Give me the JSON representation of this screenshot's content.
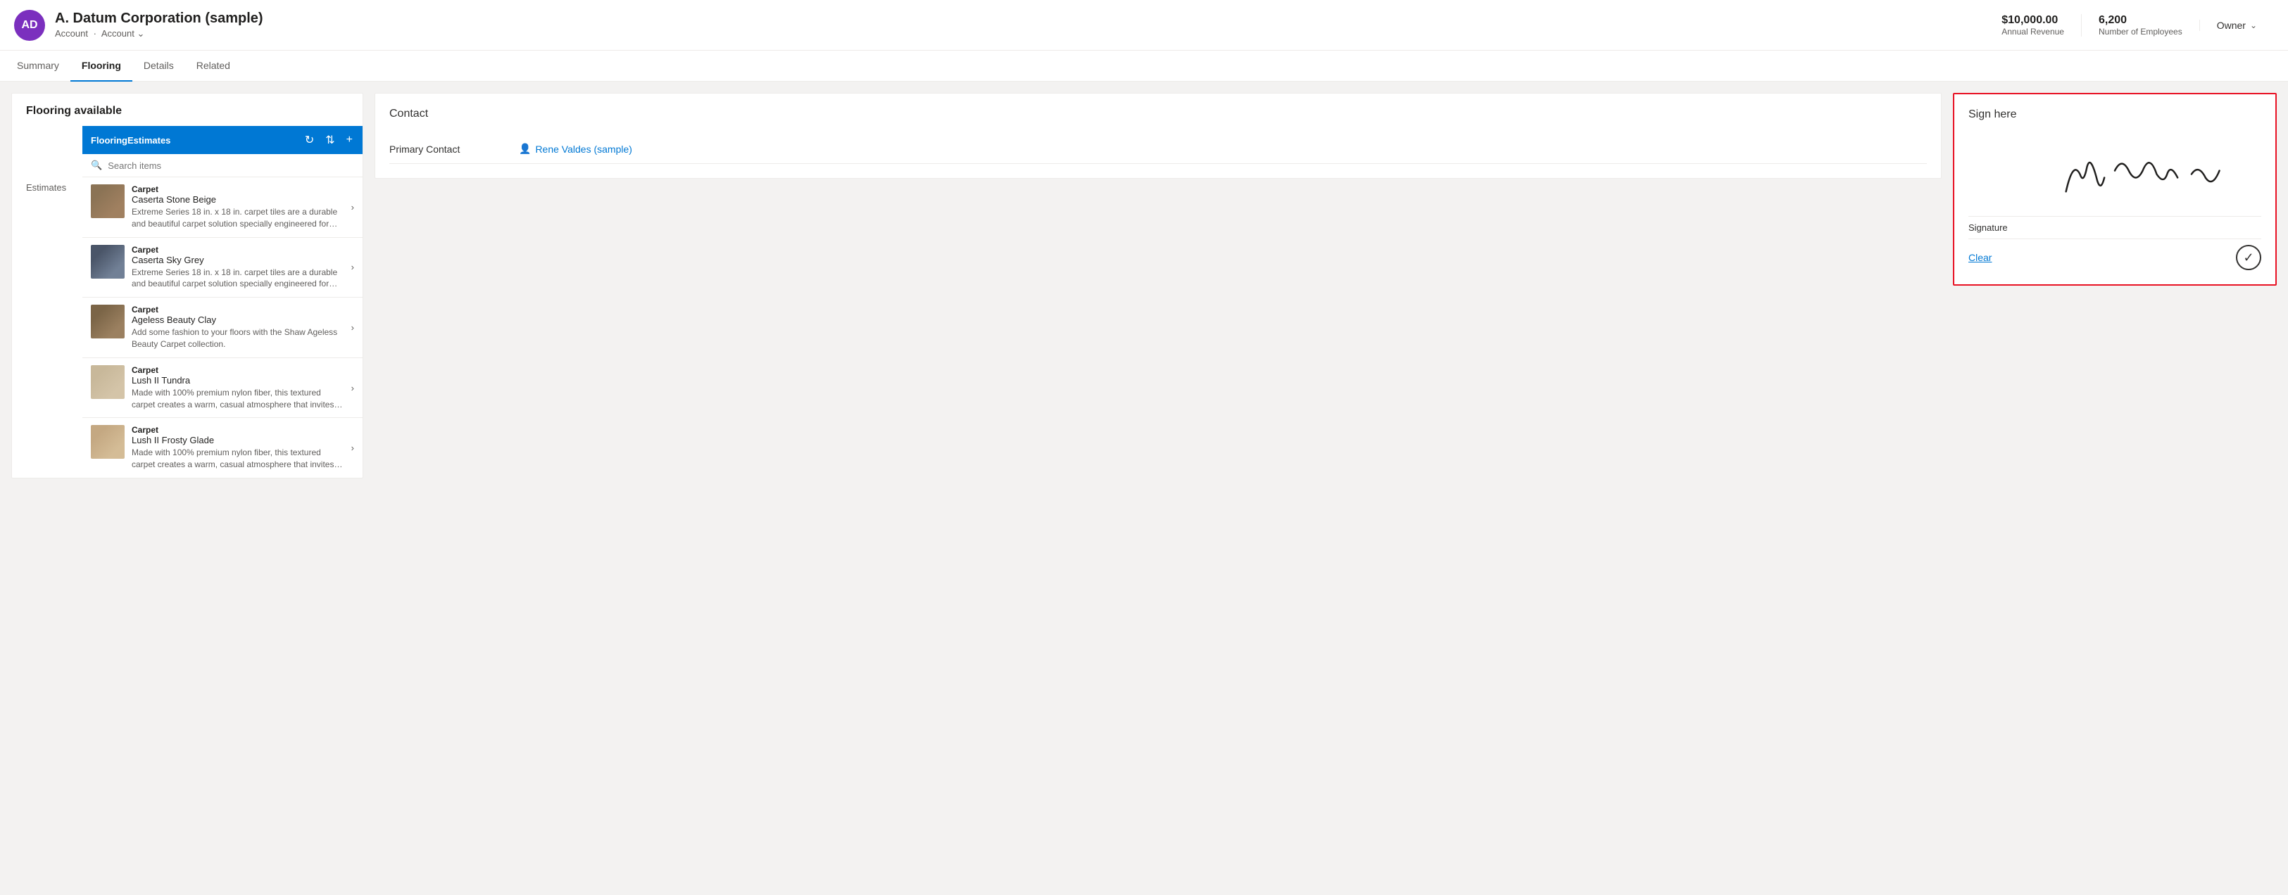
{
  "header": {
    "avatar_initials": "AD",
    "title": "A. Datum Corporation (sample)",
    "breadcrumb_part1": "Account",
    "breadcrumb_sep": "·",
    "breadcrumb_part2": "Account",
    "annual_revenue_value": "$10,000.00",
    "annual_revenue_label": "Annual Revenue",
    "employees_value": "6,200",
    "employees_label": "Number of Employees",
    "owner_label": "Owner"
  },
  "nav": {
    "tabs": [
      {
        "id": "summary",
        "label": "Summary",
        "active": false
      },
      {
        "id": "flooring",
        "label": "Flooring",
        "active": true
      },
      {
        "id": "details",
        "label": "Details",
        "active": false
      },
      {
        "id": "related",
        "label": "Related",
        "active": false
      }
    ]
  },
  "flooring_panel": {
    "title": "Flooring available",
    "estimates_label": "Estimates",
    "tab_label": "FlooringEstimates",
    "search_placeholder": "Search items",
    "products": [
      {
        "type": "Carpet",
        "name": "Caserta Stone Beige",
        "desc": "Extreme Series 18 in. x 18 in. carpet tiles are a durable and beautiful carpet solution specially engineered for both",
        "thumb_class": "thumb-beige"
      },
      {
        "type": "Carpet",
        "name": "Caserta Sky Grey",
        "desc": "Extreme Series 18 in. x 18 in. carpet tiles are a durable and beautiful carpet solution specially engineered for both",
        "thumb_class": "thumb-grey"
      },
      {
        "type": "Carpet",
        "name": "Ageless Beauty Clay",
        "desc": "Add some fashion to your floors with the Shaw Ageless Beauty Carpet collection.",
        "thumb_class": "thumb-clay"
      },
      {
        "type": "Carpet",
        "name": "Lush II Tundra",
        "desc": "Made with 100% premium nylon fiber, this textured carpet creates a warm, casual atmosphere that invites you to",
        "thumb_class": "thumb-tundra"
      },
      {
        "type": "Carpet",
        "name": "Lush II Frosty Glade",
        "desc": "Made with 100% premium nylon fiber, this textured carpet creates a warm, casual atmosphere that invites you to",
        "thumb_class": "thumb-frosty"
      }
    ]
  },
  "contact_panel": {
    "title": "Contact",
    "primary_contact_label": "Primary Contact",
    "primary_contact_value": "Rene Valdes (sample)"
  },
  "sign_panel": {
    "title": "Sign here",
    "signature_label": "Signature",
    "clear_label": "Clear"
  }
}
